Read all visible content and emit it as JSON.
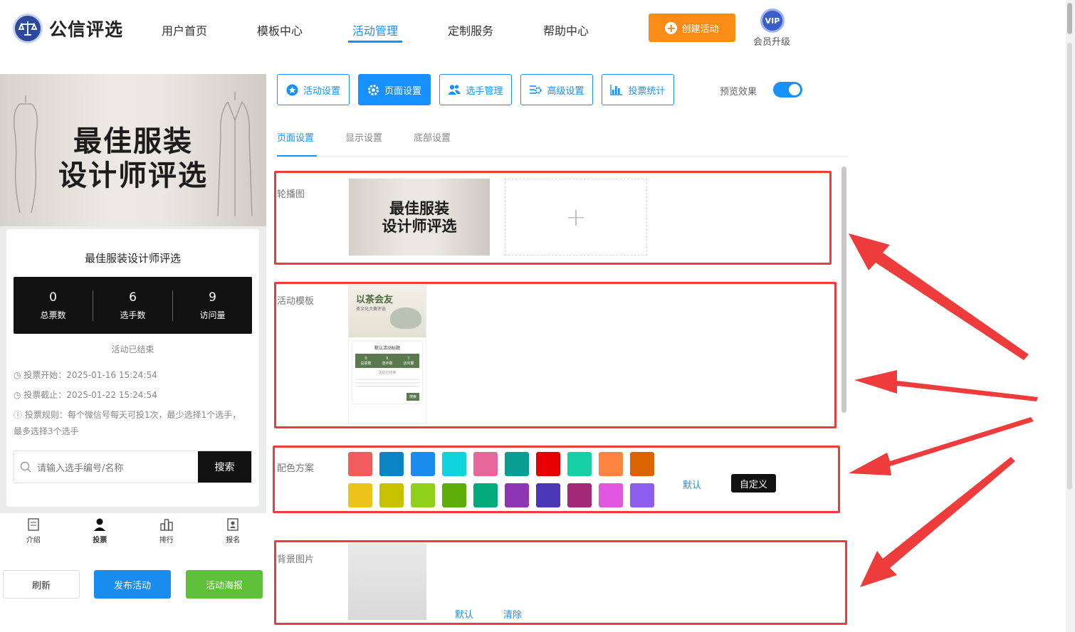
{
  "brand": {
    "name": "公信评选"
  },
  "nav": [
    {
      "label": "用户首页"
    },
    {
      "label": "模板中心"
    },
    {
      "label": "活动管理"
    },
    {
      "label": "定制服务"
    },
    {
      "label": "帮助中心"
    }
  ],
  "header": {
    "create_label": "创建活动",
    "vip_badge": "VIP",
    "vip_label": "会员升级"
  },
  "preview": {
    "banner_line1": "最佳服装",
    "banner_line2": "设计师评选",
    "title": "最佳服装设计师评选",
    "stats": [
      {
        "value": "0",
        "label": "总票数"
      },
      {
        "value": "6",
        "label": "选手数"
      },
      {
        "value": "9",
        "label": "访问量"
      }
    ],
    "status": "活动已结束",
    "vote_start": "投票开始：2025-01-16 15:24:54",
    "vote_end": "投票截止：2025-01-22 15:24:54",
    "vote_rule": "投票规则：每个微信号每天可投1次，最少选择1个选手，最多选择3个选手",
    "search_placeholder": "请输入选手编号/名称",
    "search_label": "搜索",
    "tabs": [
      "介绍",
      "投票",
      "排行",
      "报名"
    ]
  },
  "actions": {
    "refresh": "刷新",
    "publish": "发布活动",
    "poster": "活动海报"
  },
  "toolbar": [
    "活动设置",
    "页面设置",
    "选手管理",
    "高级设置",
    "投票统计"
  ],
  "preview_toggle": {
    "label": "预览效果",
    "on": true
  },
  "subtabs": [
    "页面设置",
    "显示设置",
    "底部设置"
  ],
  "sections": {
    "carousel": {
      "label": "轮播图",
      "thumb_line1": "最佳服装",
      "thumb_line2": "设计师评选",
      "add": "+"
    },
    "template": {
      "label": "活动模板"
    },
    "colors": {
      "label": "配色方案",
      "row1": [
        "#f25c5c",
        "#0b84c4",
        "#1a8cf0",
        "#10d4dc",
        "#e8679a",
        "#099e94",
        "#e60000",
        "#16d0a5",
        "#fc8340",
        "#dd6402"
      ],
      "row2": [
        "#ecc31a",
        "#c7c100",
        "#8fd11a",
        "#5eae0a",
        "#03aa7c",
        "#8e35b1",
        "#4a38b4",
        "#a42878",
        "#e257e0",
        "#8c5cec"
      ],
      "default_label": "默认",
      "custom_label": "自定义"
    },
    "background": {
      "label": "背景图片",
      "default_label": "默认",
      "clear_label": "清除"
    }
  },
  "template_preview": {
    "heading": "以茶会友",
    "sub": "茶文化大赛评选",
    "card_title": "默认活动标题",
    "stats": [
      "0",
      "5",
      "7"
    ],
    "stat_labels": [
      "总票数",
      "选手数",
      "访问量"
    ],
    "status": "活动已结束",
    "search": "搜索"
  }
}
